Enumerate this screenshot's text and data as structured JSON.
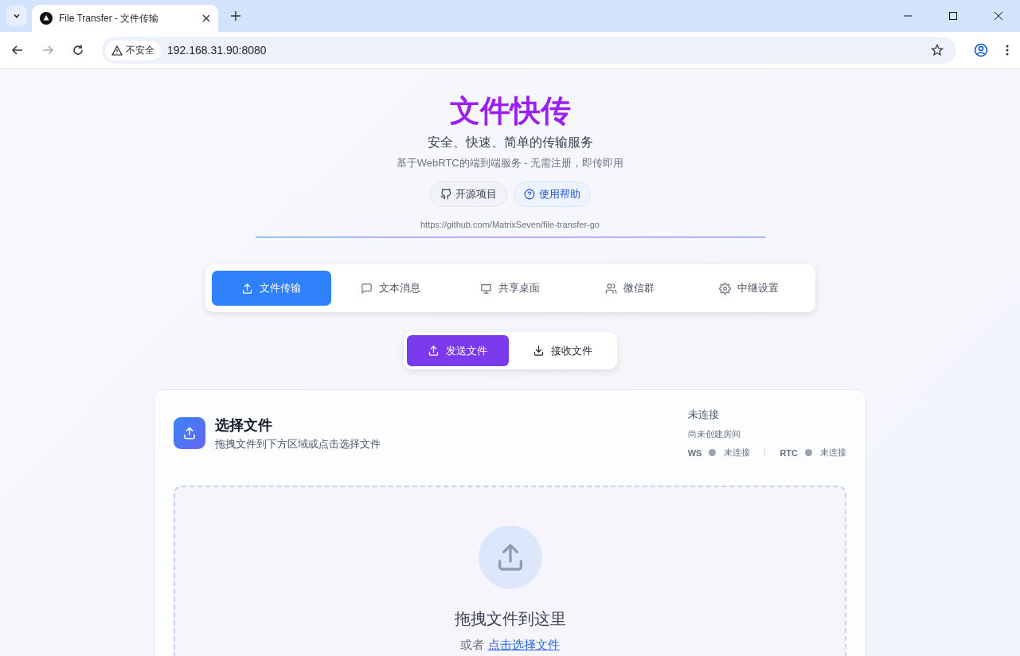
{
  "browser": {
    "tab_title": "File Transfer - 文件传输",
    "security_label": "不安全",
    "url": "192.168.31.90:8080"
  },
  "header": {
    "title": "文件快传",
    "subtitle": "安全、快速、简单的传输服务",
    "description": "基于WebRTC的端到端服务 - 无需注册，即传即用",
    "links": [
      {
        "label": "开源项目",
        "kind": "github"
      },
      {
        "label": "使用帮助",
        "kind": "help"
      }
    ],
    "repo_url": "https://github.com/MatrixSeven/file-transfer-go"
  },
  "nav_tabs": [
    {
      "label": "文件传输",
      "kind": "upload",
      "selected": true
    },
    {
      "label": "文本消息",
      "kind": "message",
      "selected": false
    },
    {
      "label": "共享桌面",
      "kind": "monitor",
      "selected": false
    },
    {
      "label": "微信群",
      "kind": "users",
      "selected": false
    },
    {
      "label": "中继设置",
      "kind": "gear",
      "selected": false
    }
  ],
  "mode_tabs": [
    {
      "label": "发送文件",
      "kind": "upload",
      "selected": true
    },
    {
      "label": "接收文件",
      "kind": "download",
      "selected": false
    }
  ],
  "card": {
    "title": "选择文件",
    "subtitle": "拖拽文件到下方区域或点击选择文件",
    "status": {
      "state": "未连接",
      "room": "尚未创建房间",
      "channels": [
        {
          "label": "WS",
          "connected": false,
          "status": "未连接"
        },
        {
          "label": "RTC",
          "connected": false,
          "status": "未连接"
        }
      ]
    }
  },
  "dropzone": {
    "title": "拖拽文件到这里",
    "prefix": "或者",
    "link": "点击选择文件"
  }
}
